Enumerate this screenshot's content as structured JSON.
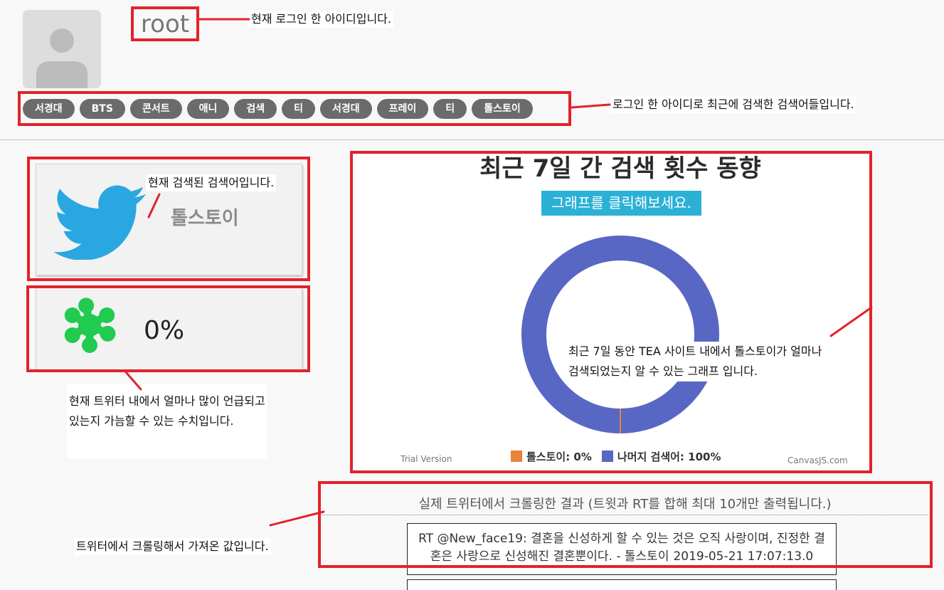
{
  "user": {
    "id": "root"
  },
  "recent_searches": [
    "서경대",
    "BTS",
    "콘서트",
    "애니",
    "검색",
    "티",
    "서경대",
    "프레이",
    "티",
    "톨스토이"
  ],
  "keyword_card": {
    "keyword": "톨스토이"
  },
  "mention_card": {
    "value": "0%"
  },
  "annotations": {
    "user_id": "현재 로그인 한 아이디입니다.",
    "recent_searches": "로그인 한 아이디로 최근에 검색한 검색어들입니다.",
    "current_keyword": "현재 검색된 검색어입니다.",
    "mention_rate": [
      "현재 트위터 내에서 얼마나 많이 언급되고",
      "있는지 가늠할 수 있는 수치입니다."
    ],
    "chart": [
      "최근 7일 동안 TEA 사이트 내에서 톨스토이가 얼마나",
      "검색되었는지 알 수 있는 그래프 입니다."
    ],
    "crawl": "트위터에서 크롤링해서 가져온 값입니다."
  },
  "chart": {
    "watermarks": {
      "left": "Trial Version",
      "right": "CanvasJS.com"
    }
  },
  "chart_data": {
    "type": "pie",
    "variant": "doughnut",
    "title": "최근 7일 간 검색 횟수 동향",
    "subtitle": "그래프를 클릭해보세요.",
    "categories": [
      "톨스토이",
      "나머지 검색어"
    ],
    "values": [
      0,
      100
    ],
    "legend": [
      "톨스토이: 0%",
      "나머지 검색어: 100%"
    ],
    "legend_placement": "bottom",
    "colors": [
      "#e8833a",
      "#5867c3"
    ]
  },
  "tweets": {
    "header": "실제 트위터에서 크롤링한 결과 (트윗과 RT를 합해 최대 10개만 출력됩니다.)",
    "items": [
      {
        "text": "RT @New_face19: 결혼을 신성하게 할 수 있는 것은 오직 사랑이며, 진정한 결혼은 사랑으로 신성해진 결혼뿐이다. - 톨스토이",
        "date": "2019-05-21 17:07:13.0"
      }
    ]
  },
  "icons": {
    "avatar": "user-avatar-icon",
    "keyword": "twitter-bird-icon",
    "mention": "green-splat-icon"
  },
  "colors": {
    "annotation_red": "#e3222b",
    "chip_bg": "#6b6b6b",
    "button_teal": "#2bb1d6",
    "twitter_blue": "#2aa7e1",
    "mention_green": "#20cb4f"
  }
}
